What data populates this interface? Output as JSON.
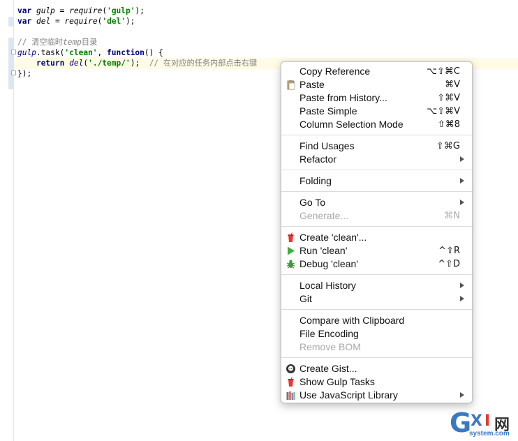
{
  "editor": {
    "lines": {
      "l1": {
        "kw": "var",
        "var": "gulp",
        "eq": "=",
        "fn": "require",
        "str": "'gulp'",
        "end": ");"
      },
      "l2": {
        "kw": "var",
        "var": "del",
        "eq": "=",
        "fn": "require",
        "str": "'del'",
        "end": ");"
      },
      "l4": {
        "comment_prefix": "// 清空临时",
        "comment_it": "temp",
        "comment_suffix": "目录"
      },
      "l5": {
        "obj": "gulp",
        "dot": ".task(",
        "str": "'clean'",
        "sep": ", ",
        "kw": "function",
        "rest": "() {"
      },
      "l6": {
        "kw": "return",
        "fn": "del",
        "open": "(",
        "str": "'./temp/'",
        "close": ");",
        "comment": "// 在对应的任务内部点击右键"
      },
      "l7": {
        "text": "});"
      }
    }
  },
  "context_menu": {
    "copy_reference": {
      "label": "Copy Reference",
      "shortcut": "⌥⇧⌘C"
    },
    "paste": {
      "label": "Paste",
      "shortcut": "⌘V",
      "icon": "clipboard-icon"
    },
    "paste_from_history": {
      "label": "Paste from History...",
      "shortcut": "⇧⌘V"
    },
    "paste_simple": {
      "label": "Paste Simple",
      "shortcut": "⌥⇧⌘V"
    },
    "column_selection_mode": {
      "label": "Column Selection Mode",
      "shortcut": "⇧⌘8"
    },
    "find_usages": {
      "label": "Find Usages",
      "shortcut": "⇧⌘G"
    },
    "refactor": {
      "label": "Refactor"
    },
    "folding": {
      "label": "Folding"
    },
    "go_to": {
      "label": "Go To"
    },
    "generate": {
      "label": "Generate...",
      "shortcut": "⌘N",
      "disabled": true
    },
    "create_clean": {
      "label": "Create 'clean'...",
      "icon": "gulp-icon"
    },
    "run_clean": {
      "label": "Run 'clean'",
      "shortcut": "^⇧R",
      "icon": "run-icon"
    },
    "debug_clean": {
      "label": "Debug 'clean'",
      "shortcut": "^⇧D",
      "icon": "debug-bug-icon"
    },
    "local_history": {
      "label": "Local History"
    },
    "git": {
      "label": "Git"
    },
    "compare_with_clipboard": {
      "label": "Compare with Clipboard"
    },
    "file_encoding": {
      "label": "File Encoding"
    },
    "remove_bom": {
      "label": "Remove BOM",
      "disabled": true
    },
    "create_gist": {
      "label": "Create Gist...",
      "icon": "github-icon"
    },
    "show_gulp_tasks": {
      "label": "Show Gulp Tasks",
      "icon": "gulp-icon"
    },
    "use_js_library": {
      "label": "Use JavaScript Library",
      "icon": "library-icon"
    }
  },
  "watermark": {
    "g": "G",
    "x": "X",
    "i": "I",
    "cn": "网",
    "url": "system.com"
  },
  "colors": {
    "keyword": "#000080",
    "string": "#008000",
    "comment": "#808080",
    "menu_bg": "#ffffff",
    "disabled": "#a8a8a8"
  }
}
